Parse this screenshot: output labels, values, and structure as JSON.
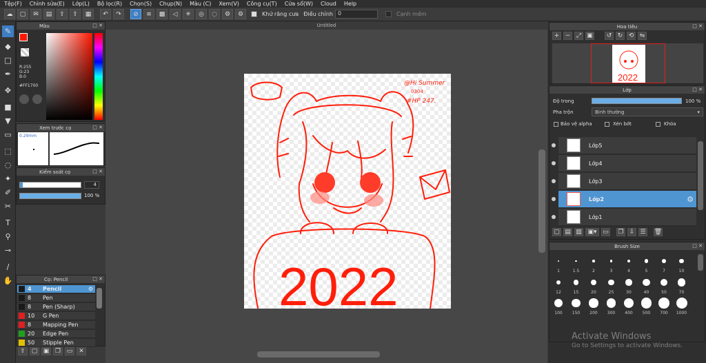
{
  "menu": [
    "Tệp(F)",
    "Chỉnh sửa(E)",
    "Lớp(L)",
    "Bộ lọc(R)",
    "Chọn(S)",
    "Chụp(N)",
    "Màu (C)",
    "Xem(V)",
    "Công cụ(T)",
    "Cửa sổ(W)",
    "Cloud",
    "Help"
  ],
  "toolbar": {
    "antialias": "Khử răng cưa",
    "adjust": "Điều chỉnh",
    "adjust_value": "0",
    "snap": "Cạnh mềm"
  },
  "color_panel": {
    "title": "Màu",
    "r": "R:255",
    "g": "G:23",
    "b": "B:0",
    "hex": "#FF1700",
    "fg": "#ff1700"
  },
  "brush_preview": {
    "title": "Xem trước cọ",
    "size": "0.29mm"
  },
  "brush_control": {
    "title": "Kiểm soát cọ",
    "size": "4",
    "opacity": "100 %"
  },
  "brush_list": {
    "title": "Cọ: Pencil",
    "items": [
      {
        "size": "4",
        "name": "Pencil",
        "color": "#1a1a1a"
      },
      {
        "size": "8",
        "name": "Pen",
        "color": "#1a1a1a"
      },
      {
        "size": "8",
        "name": "Pen (Sharp)",
        "color": "#1a1a1a"
      },
      {
        "size": "10",
        "name": "G Pen",
        "color": "#e02020"
      },
      {
        "size": "8",
        "name": "Mapping Pen",
        "color": "#e02020"
      },
      {
        "size": "20",
        "name": "Edge Pen",
        "color": "#20a020"
      },
      {
        "size": "50",
        "name": "Stipple Pen",
        "color": "#e0c000"
      }
    ]
  },
  "canvas": {
    "title": "Untitled",
    "signature": [
      "@Hi Summer",
      "0304",
      "#HP 247."
    ],
    "year": "2022"
  },
  "navigator": {
    "title": "Hoa tiêu"
  },
  "layers": {
    "title": "Lớp",
    "opacity_label": "Độ trong",
    "opacity_value": "100 %",
    "blend_label": "Pha trộn",
    "blend_value": "Bình thường",
    "protect_alpha": "Bảo vệ alpha",
    "clipping": "Xén bớt",
    "lock": "Khóa",
    "items": [
      {
        "name": "Lớp5"
      },
      {
        "name": "Lớp4"
      },
      {
        "name": "Lớp3"
      },
      {
        "name": "Lớp2",
        "selected": true
      },
      {
        "name": "Lớp1"
      }
    ]
  },
  "brush_size": {
    "title": "Brush Size",
    "sizes": [
      "1",
      "1.5",
      "2",
      "3",
      "4",
      "5",
      "7",
      "10",
      "12",
      "15",
      "20",
      "25",
      "30",
      "40",
      "50",
      "70",
      "100",
      "150",
      "200",
      "300",
      "400",
      "500",
      "700",
      "1000"
    ]
  },
  "watermark": {
    "line1": "Activate Windows",
    "line2": "Go to Settings to activate Windows."
  }
}
